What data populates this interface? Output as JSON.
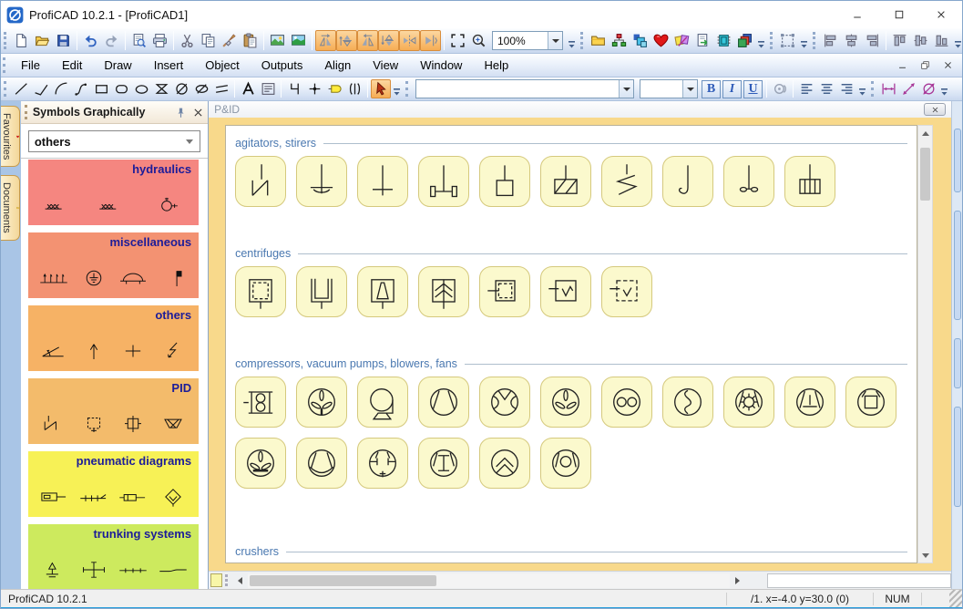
{
  "titlebar": {
    "title": "ProfiCAD 10.2.1 - [ProfiCAD1]"
  },
  "menubar": {
    "items": [
      "File",
      "Edit",
      "Draw",
      "Insert",
      "Object",
      "Outputs",
      "Align",
      "View",
      "Window",
      "Help"
    ]
  },
  "combos": {
    "zoom": "100%",
    "font": "",
    "size": ""
  },
  "format": {
    "bold": "B",
    "italic": "I",
    "underline": "U"
  },
  "toolbar_main": {
    "segments": [
      {
        "buttons": [
          "new",
          "open",
          "save",
          "|",
          "undo",
          "redo",
          "|",
          "print-preview",
          "print",
          "|",
          "cut",
          "copy",
          "format-painter",
          "paste",
          "|",
          "insert-image",
          "insert-image-alt",
          "|",
          "!rotate-left",
          "!flip-vertical",
          "!rotate-right",
          "!flip-down",
          "!flip-horizontal",
          "!mirror-horizontal",
          "|",
          "select-area",
          "zoom-in",
          "combo:zoom"
        ]
      },
      {
        "buttons": [
          "folder",
          "scheme",
          "pages",
          "favourites",
          "notes",
          "export",
          "integrated-circuit",
          "layers"
        ]
      },
      {
        "buttons": [
          "group"
        ]
      },
      {
        "buttons": [
          "align-left-edges",
          "align-center",
          "align-right-edges",
          "|",
          "align-top-edges",
          "align-middle",
          "align-bottom-edges"
        ]
      }
    ]
  },
  "toolbar_draw": {
    "segments": [
      {
        "buttons": [
          "line",
          "polyline",
          "arc",
          "curve",
          "rectangle",
          "rounded-rectangle",
          "ellipse",
          "hourglass",
          "crossed-circle",
          "crossed-ellipse",
          "parallel-lines",
          "|",
          "text",
          "text-block",
          "|",
          "gate",
          "junction",
          "label",
          "connector",
          "|",
          "!pointer"
        ]
      },
      {
        "buttons": [
          "combo:font",
          "combo:size",
          "fmt:bold",
          "fmt:italic",
          "fmt:underline",
          "|",
          "special-characters",
          "|",
          "align-text-left",
          "align-text-center",
          "align-text-right"
        ]
      },
      {
        "buttons": [
          "dimension-linear",
          "dimension-aligned",
          "dimension-diameter"
        ]
      }
    ]
  },
  "sidebar": {
    "tabs": [
      {
        "label": "Favourites",
        "icon": "heart-icon"
      },
      {
        "label": "Documents",
        "icon": "folder-icon"
      }
    ],
    "panel_title": "Symbols Graphically",
    "dropdown_value": "others",
    "categories": [
      {
        "label": "hydraulics",
        "color": "#f58680",
        "symbols": [
          "pump-train",
          "pump-train-2",
          "hydraulic-motor"
        ]
      },
      {
        "label": "miscellaneous",
        "color": "#f39272",
        "symbols": [
          "fence",
          "earthing-circle",
          "dome",
          "flag"
        ]
      },
      {
        "label": "others",
        "color": "#f6b265",
        "symbols": [
          "angle",
          "arrow-up",
          "plus",
          "lightning-arrow"
        ]
      },
      {
        "label": "PID",
        "color": "#f3bb6b",
        "symbols": [
          "zigzag-agitator",
          "dashed-vessel",
          "crossed-vessel",
          "trapezoid-x"
        ]
      },
      {
        "label": "pneumatic diagrams",
        "color": "#f7f156",
        "symbols": [
          "cylinder",
          "valve-train",
          "cylinder-2",
          "filter-diamond"
        ]
      },
      {
        "label": "trunking systems",
        "color": "#cdea5e",
        "symbols": [
          "earth-pole",
          "cross-ticks",
          "tick-line",
          "tick-line-step"
        ]
      }
    ]
  },
  "document": {
    "title": "P&ID",
    "sections": [
      {
        "label": "agitators, stirers",
        "symbols": [
          "agitator-zigzag",
          "agitator-anchor",
          "agitator-paddle",
          "agitator-impeller",
          "agitator-square",
          "agitator-crossed-box",
          "agitator-helix",
          "agitator-hook",
          "agitator-propeller",
          "agitator-cells"
        ]
      },
      {
        "label": "centrifuges",
        "symbols": [
          "centrifuge-dashed",
          "centrifuge-open",
          "centrifuge-cone",
          "centrifuge-chevrons",
          "centrifuge-side-dashed",
          "centrifuge-wave",
          "centrifuge-wave-dashed"
        ]
      },
      {
        "label": "compressors, vacuum pumps, blowers, fans",
        "symbols": [
          "roots-blower",
          "fan-propeller-stem",
          "volute-fan",
          "compressor-trapezoid",
          "curved-vane-fan",
          "fan-propeller",
          "twin-lobe",
          "screw-compressor",
          "sun-wheel",
          "compressor-tee",
          "compressor-square",
          "fan-propeller-bar",
          "liquid-ring",
          "compressor-tees",
          "compressor-ibeam",
          "double-chevron",
          "ring-compressor"
        ]
      },
      {
        "label": "crushers",
        "symbols": []
      }
    ]
  },
  "statusbar": {
    "app": "ProfiCAD 10.2.1",
    "coordinates": "/1.  x=-4.0  y=30.0 (0)",
    "num_lock": "NUM"
  }
}
